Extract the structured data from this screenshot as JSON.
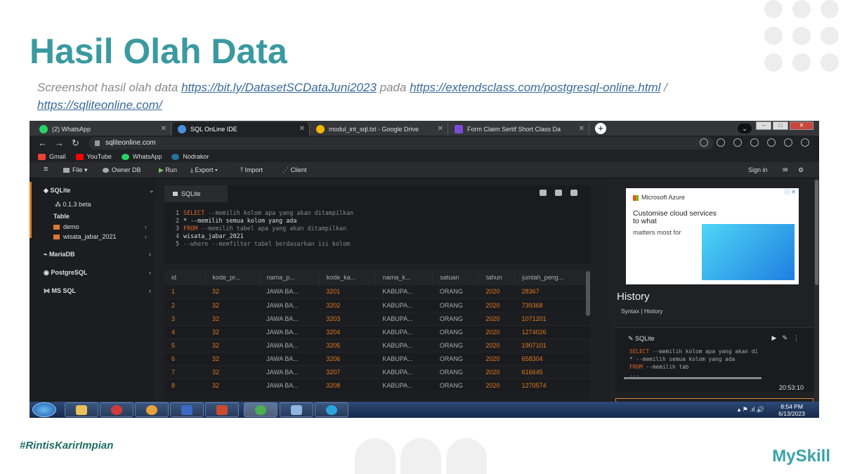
{
  "slide": {
    "title": "Hasil Olah Data",
    "subtitle_prefix": "Screenshot hasil olah data ",
    "link1": "https://bit.ly/DatasetSCDataJuni2023",
    "subtitle_mid": " pada ",
    "link2": "https://extendsclass.com/postgresql-online.html",
    "subtitle_sep": " / ",
    "link3": "https://sqliteonline.com/",
    "hashtag": "#RintisKarirImpian",
    "logo": "MySkill"
  },
  "browser": {
    "tabs": [
      {
        "label": "(2) WhatsApp",
        "color": "#25d366"
      },
      {
        "label": "SQL OnLine IDE",
        "color": "#4a90d9"
      },
      {
        "label": "modul_int_sql.txt - Google Drive",
        "color": "#f4b400"
      },
      {
        "label": "Form Claim Sertif Short Class Da",
        "color": "#7b4bd6"
      }
    ],
    "new_tab": "+",
    "url": "sqliteonline.com",
    "bookmarks": [
      {
        "label": "Gmail",
        "color": "#ea4335"
      },
      {
        "label": "YouTube",
        "color": "#ff0000"
      },
      {
        "label": "WhatsApp",
        "color": "#25d366"
      },
      {
        "label": "Nodrakor",
        "color": "#21759b"
      }
    ]
  },
  "toolbar": {
    "file": "File",
    "owner": "Owner DB",
    "run": "Run",
    "export": "Export",
    "import": "Import",
    "client": "Client",
    "signin": "Sign in"
  },
  "sidebar": {
    "sqlite": "SQLite",
    "version": "0.1.3 beta",
    "table_header": "Table",
    "t1": "demo",
    "t2": "wisata_jabar_2021",
    "mariadb": "MariaDB",
    "postgres": "PostgreSQL",
    "mssql": "MS SQL"
  },
  "editor": {
    "tab": "SQLite",
    "lines": [
      {
        "n": "1",
        "kw": "SELECT",
        "rest": " --memilih kolom apa yang akan ditampilkan"
      },
      {
        "n": "2",
        "kw": "",
        "rest": "* --memilih semua kolom yang ada"
      },
      {
        "n": "3",
        "kw": "FROM",
        "rest": " --memilih tabel apa yang akan ditampilkan"
      },
      {
        "n": "4",
        "kw": "",
        "rest": "wisata_jabar_2021"
      },
      {
        "n": "5",
        "kw": "",
        "rest": "--where --memfilter tabel berdasarkan isi kolom"
      }
    ]
  },
  "grid": {
    "columns": [
      "id",
      "kode_pr...",
      "nama_p...",
      "kode_ka...",
      "nama_k...",
      "satuan",
      "tahun",
      "jumlah_peng..."
    ],
    "rows": [
      [
        "1",
        "32",
        "JAWA BA...",
        "3201",
        "KABUPA...",
        "ORANG",
        "2020",
        "28367"
      ],
      [
        "2",
        "32",
        "JAWA BA...",
        "3202",
        "KABUPA...",
        "ORANG",
        "2020",
        "739368"
      ],
      [
        "3",
        "32",
        "JAWA BA...",
        "3203",
        "KABUPA...",
        "ORANG",
        "2020",
        "1071201"
      ],
      [
        "4",
        "32",
        "JAWA BA...",
        "3204",
        "KABUPA...",
        "ORANG",
        "2020",
        "1274026"
      ],
      [
        "5",
        "32",
        "JAWA BA...",
        "3205",
        "KABUPA...",
        "ORANG",
        "2020",
        "1907101"
      ],
      [
        "6",
        "32",
        "JAWA BA...",
        "3206",
        "KABUPA...",
        "ORANG",
        "2020",
        "658304"
      ],
      [
        "7",
        "32",
        "JAWA BA...",
        "3207",
        "KABUPA...",
        "ORANG",
        "2020",
        "616645"
      ],
      [
        "8",
        "32",
        "JAWA BA...",
        "3208",
        "KABUPA...",
        "ORANG",
        "2020",
        "1270574"
      ]
    ]
  },
  "ad": {
    "brand": "Microsoft Azure",
    "headline": "Customise cloud services to what",
    "sub": "matters most for"
  },
  "history": {
    "title": "History",
    "tabs": "Syntax  |  History",
    "card_title": "SQLite",
    "code": [
      {
        "kw": "SELECT",
        "rest": " --memilih kolom apa yang akan di"
      },
      {
        "kw": "",
        "rest": "* --memilih semua kolom yang ada"
      },
      {
        "kw": "FROM",
        "rest": " --memilih tab"
      },
      {
        "kw": "",
        "rest": "..."
      }
    ],
    "time": "20:53:10"
  },
  "taskbar": {
    "time": "8:54 PM",
    "date": "6/13/2023"
  }
}
